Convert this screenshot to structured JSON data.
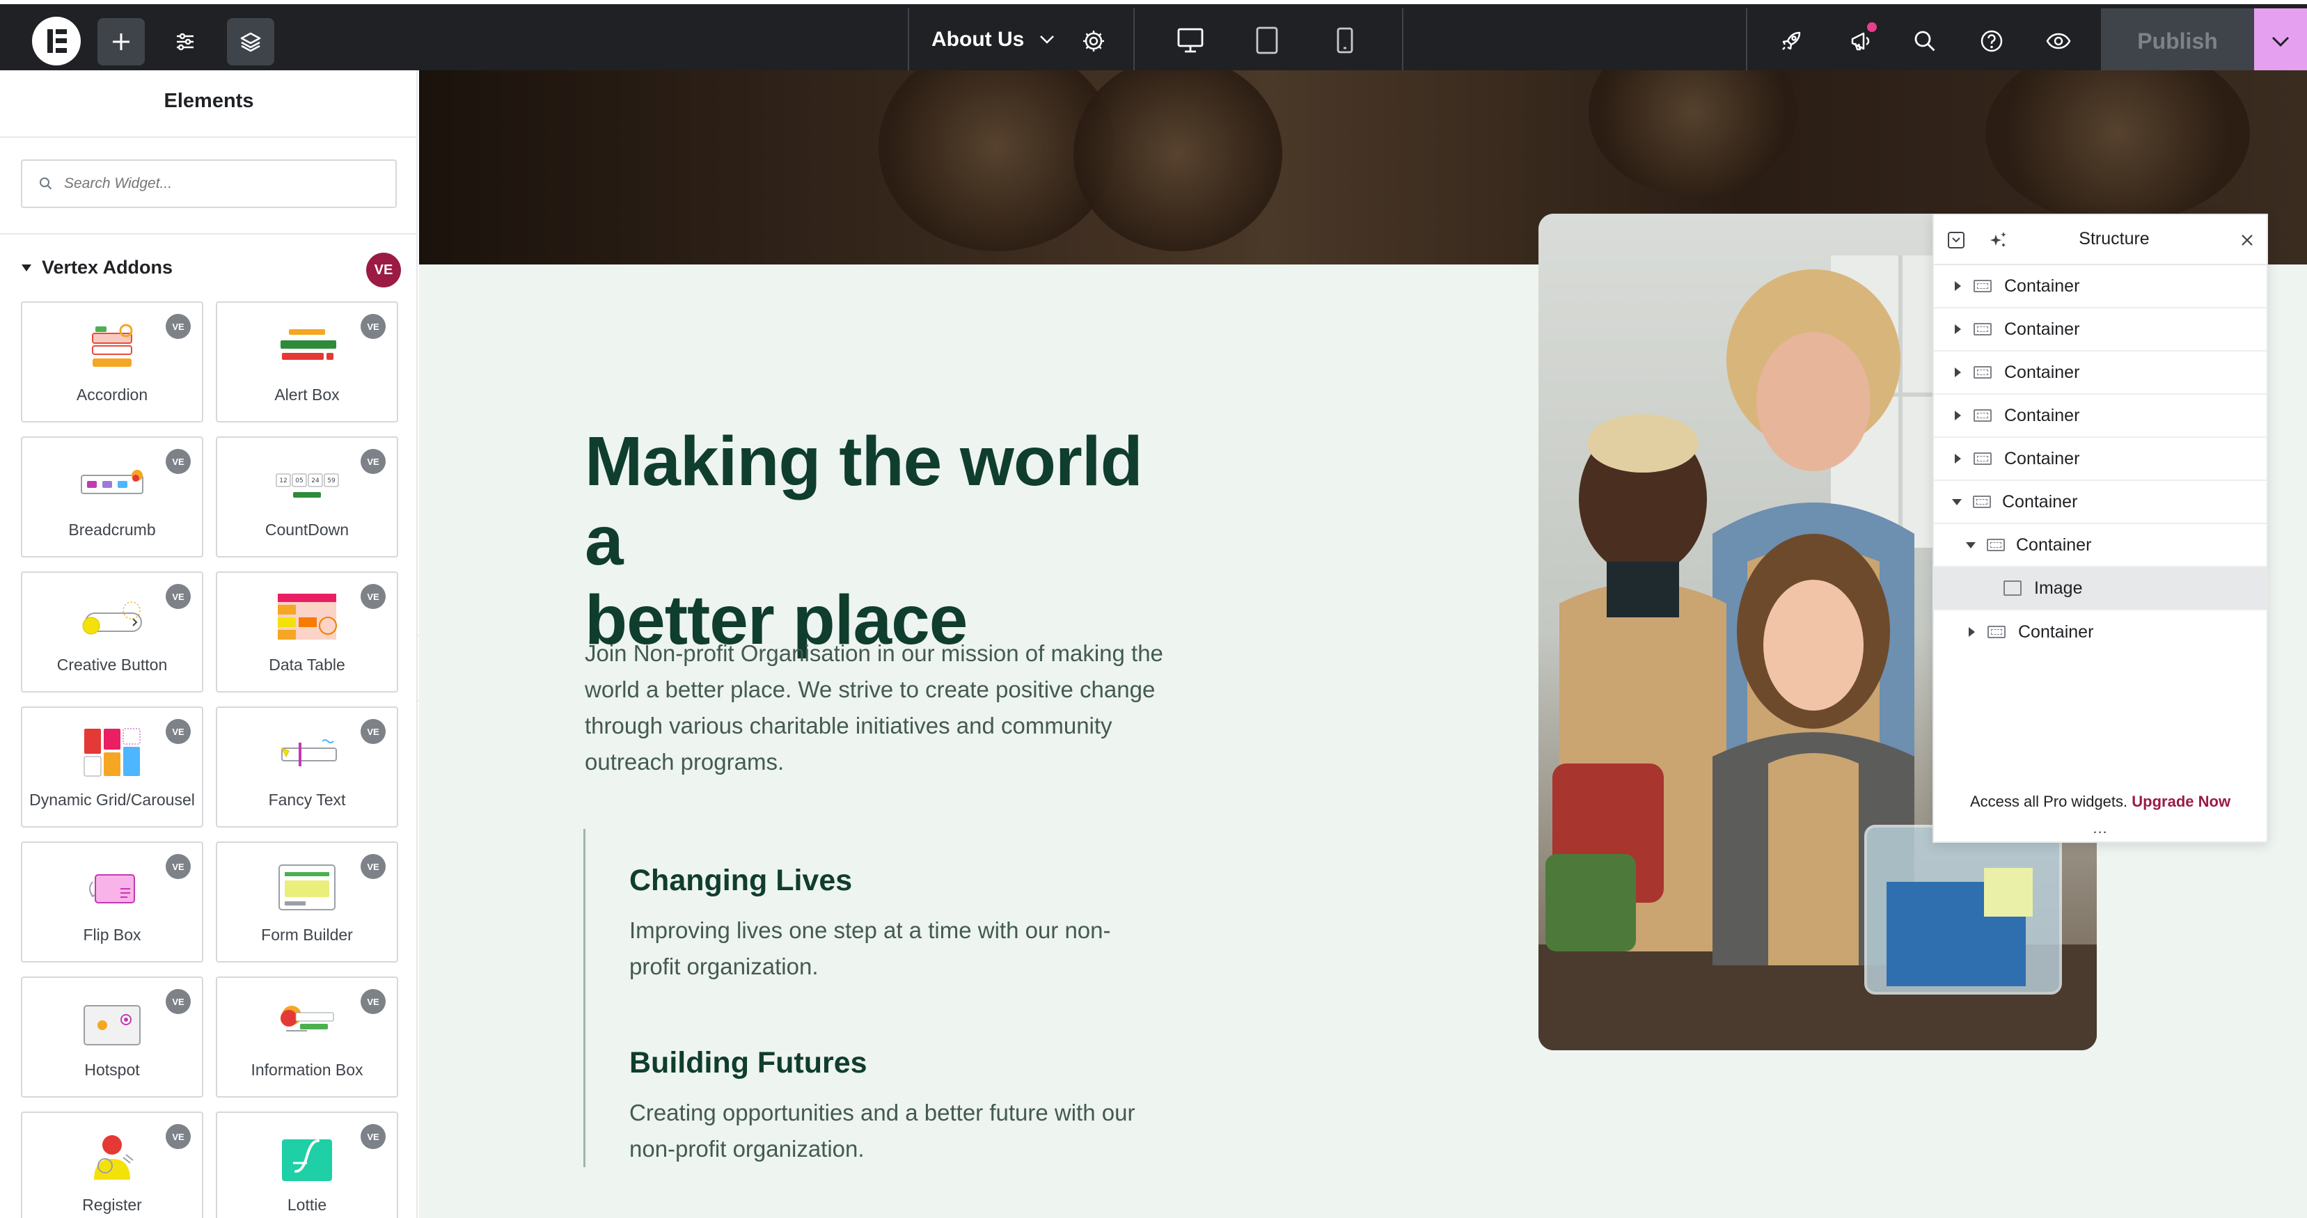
{
  "topbar": {
    "page_title": "About Us",
    "publish_label": "Publish",
    "colors": {
      "bar": "#1f2124",
      "publish_bg": "#3f444b",
      "publish_dropdown": "#e5a0f0",
      "notification_dot": "#e83e8c"
    }
  },
  "panel": {
    "title": "Elements",
    "search_placeholder": "Search Widget...",
    "category": {
      "label": "Vertex Addons",
      "badge": "VE"
    },
    "widget_badge": "VE",
    "widgets": [
      {
        "label": "Accordion",
        "icon": "accordion-icon"
      },
      {
        "label": "Alert Box",
        "icon": "alert-box-icon"
      },
      {
        "label": "Breadcrumb",
        "icon": "breadcrumb-icon"
      },
      {
        "label": "CountDown",
        "icon": "countdown-icon"
      },
      {
        "label": "Creative Button",
        "icon": "creative-button-icon"
      },
      {
        "label": "Data Table",
        "icon": "data-table-icon"
      },
      {
        "label": "Dynamic Grid/Carousel",
        "icon": "dynamic-grid-icon"
      },
      {
        "label": "Fancy Text",
        "icon": "fancy-text-icon"
      },
      {
        "label": "Flip Box",
        "icon": "flip-box-icon"
      },
      {
        "label": "Form Builder",
        "icon": "form-builder-icon"
      },
      {
        "label": "Hotspot",
        "icon": "hotspot-icon"
      },
      {
        "label": "Information Box",
        "icon": "information-box-icon"
      },
      {
        "label": "Register",
        "icon": "register-icon"
      },
      {
        "label": "Lottie",
        "icon": "lottie-icon"
      }
    ],
    "countdown_digits": [
      "12",
      "05",
      "24",
      "59"
    ]
  },
  "canvas": {
    "heading_line1": "Making the world a",
    "heading_line2": "better place",
    "intro": "Join Non-profit Organisation in our mission of making the world a better place. We strive to create positive change through various charitable initiatives and community outreach programs.",
    "features": [
      {
        "title": "Changing Lives",
        "text": "Improving lives one step at a time with our non-profit organization."
      },
      {
        "title": "Building Futures",
        "text": "Creating opportunities and a better future with our non-profit organization."
      }
    ],
    "colors": {
      "background": "#eef4f0",
      "heading": "#0f3d2e",
      "body_text": "#435a51"
    }
  },
  "structure": {
    "title": "Structure",
    "rows": [
      {
        "label": "Container",
        "expanded": false,
        "level": 0,
        "icon": "container-icon"
      },
      {
        "label": "Container",
        "expanded": false,
        "level": 0,
        "icon": "container-icon"
      },
      {
        "label": "Container",
        "expanded": false,
        "level": 0,
        "icon": "container-icon"
      },
      {
        "label": "Container",
        "expanded": false,
        "level": 0,
        "icon": "container-icon"
      },
      {
        "label": "Container",
        "expanded": false,
        "level": 0,
        "icon": "container-icon"
      },
      {
        "label": "Container",
        "expanded": true,
        "level": 0,
        "icon": "container-icon"
      },
      {
        "label": "Container",
        "expanded": true,
        "level": 1,
        "icon": "container-icon"
      },
      {
        "label": "Image",
        "selected": true,
        "level": 2,
        "icon": "image-icon"
      },
      {
        "label": "Container",
        "expanded": false,
        "level": 1,
        "icon": "container-icon"
      }
    ],
    "footer_text": "Access all Pro widgets.",
    "footer_link": "Upgrade Now",
    "more": "..."
  }
}
